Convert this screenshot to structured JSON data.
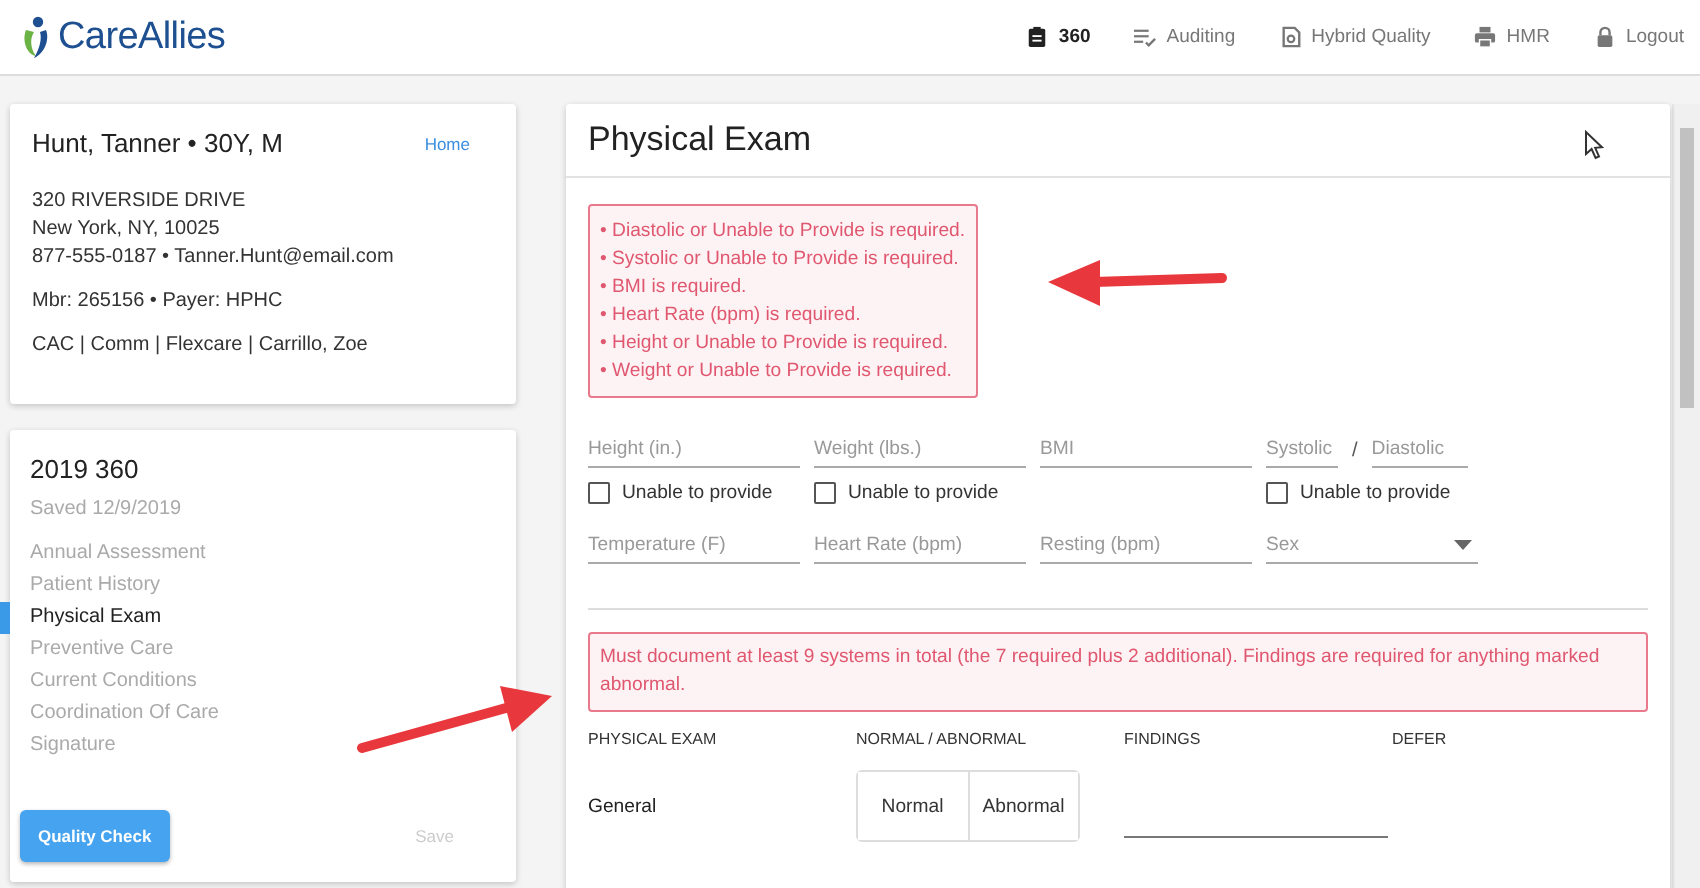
{
  "header": {
    "logo": "CareAllies",
    "nav": [
      {
        "label": "360",
        "kind": "clipboard",
        "selected": true
      },
      {
        "label": "Auditing",
        "kind": "checklist",
        "selected": false
      },
      {
        "label": "Hybrid Quality",
        "kind": "document",
        "selected": false
      },
      {
        "label": "HMR",
        "kind": "printer",
        "selected": false
      },
      {
        "label": "Logout",
        "kind": "lock",
        "selected": false
      }
    ]
  },
  "patient": {
    "name": "Hunt, Tanner •  30Y,  M",
    "home_link": "Home",
    "address": [
      "320 RIVERSIDE DRIVE",
      "New York, NY, 10025",
      "877-555-0187 • Tanner.Hunt@email.com"
    ],
    "member": "Mbr: 265156 • Payer: HPHC",
    "tags": "CAC | Comm | Flexcare  |  Carrillo, Zoe"
  },
  "assessment": {
    "title": "2019 360",
    "saved": "Saved 12/9/2019",
    "steps": [
      {
        "label": "Annual Assessment",
        "selected": false
      },
      {
        "label": "Patient History",
        "selected": false
      },
      {
        "label": "Physical Exam",
        "selected": true
      },
      {
        "label": "Preventive Care",
        "selected": false
      },
      {
        "label": "Current Conditions",
        "selected": false
      },
      {
        "label": "Coordination Of Care",
        "selected": false
      },
      {
        "label": "Signature",
        "selected": false
      }
    ],
    "quality_button": "Quality Check",
    "save_button": {
      "label": "Save",
      "disabled": true
    }
  },
  "exam": {
    "title": "Physical Exam",
    "errors": [
      "• Diastolic or Unable to Provide is required.",
      "• Systolic or Unable to Provide is required.",
      "• BMI is required.",
      "• Heart Rate (bpm) is required.",
      "• Height or Unable to Provide is required.",
      "• Weight or Unable to Provide is required."
    ],
    "vitals": [
      {
        "kind": "text",
        "placeholder": "Height (in.)",
        "unable": {
          "label": "Unable to provide",
          "checked": false
        }
      },
      {
        "kind": "text",
        "placeholder": "Weight (lbs.)",
        "unable": {
          "label": "Unable to provide",
          "checked": false
        }
      },
      {
        "kind": "text",
        "placeholder": "BMI"
      },
      {
        "kind": "pair",
        "placeholder": "Systolic",
        "separator": "/",
        "second_placeholder": "Diastolic",
        "unable": {
          "label": "Unable to provide",
          "checked": false
        }
      },
      {
        "kind": "text",
        "placeholder": "Temperature (F)"
      },
      {
        "kind": "text",
        "placeholder": "Heart Rate (bpm)"
      },
      {
        "kind": "text",
        "placeholder": "Resting (bpm)"
      },
      {
        "kind": "select",
        "placeholder": "Sex"
      }
    ],
    "notice": "Must document at least 9 systems in total (the 7 required plus 2 additional). Findings are required for anything marked abnormal.",
    "columns": [
      "PHYSICAL EXAM",
      "NORMAL / ABNORMAL",
      "FINDINGS",
      "DEFER"
    ],
    "rows": [
      {
        "label": "General",
        "options": [
          "Normal",
          "Abnormal"
        ]
      }
    ]
  }
}
